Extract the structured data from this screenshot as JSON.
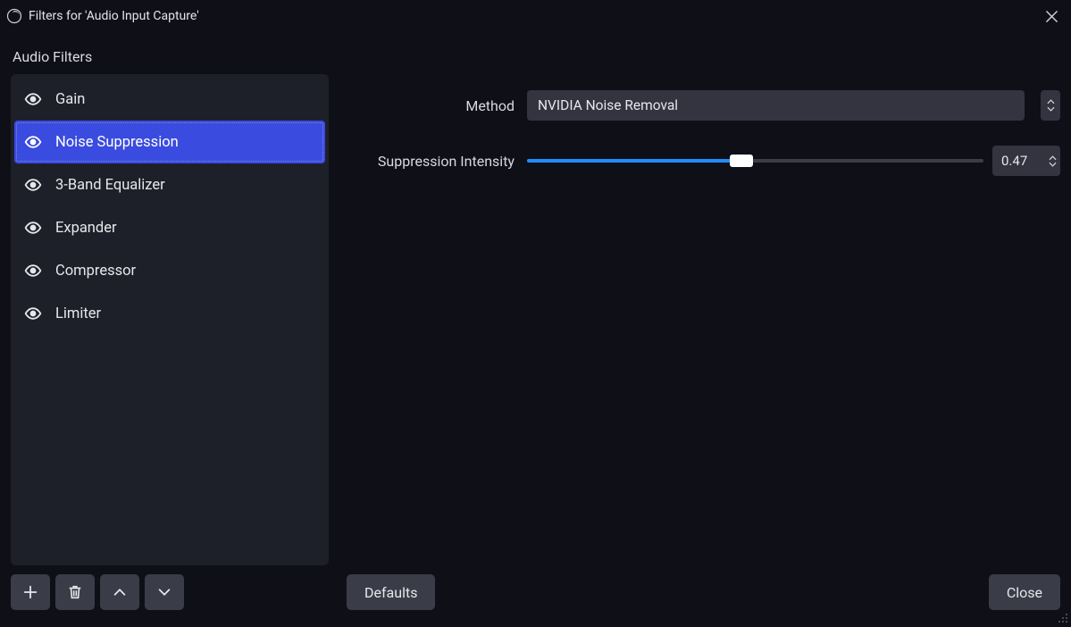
{
  "titlebar": {
    "title": "Filters for 'Audio Input Capture'"
  },
  "section_label": "Audio Filters",
  "filters": [
    {
      "name": "Gain",
      "selected": false
    },
    {
      "name": "Noise Suppression",
      "selected": true
    },
    {
      "name": "3-Band Equalizer",
      "selected": false
    },
    {
      "name": "Expander",
      "selected": false
    },
    {
      "name": "Compressor",
      "selected": false
    },
    {
      "name": "Limiter",
      "selected": false
    }
  ],
  "props": {
    "method_label": "Method",
    "method_value": "NVIDIA Noise Removal",
    "intensity_label": "Suppression Intensity",
    "intensity_value": "0.47",
    "intensity_fraction": 0.47
  },
  "buttons": {
    "defaults": "Defaults",
    "close": "Close"
  },
  "icons": {
    "add": "plus-icon",
    "delete": "trash-icon",
    "move_up": "chevron-up-icon",
    "move_down": "chevron-down-icon"
  }
}
